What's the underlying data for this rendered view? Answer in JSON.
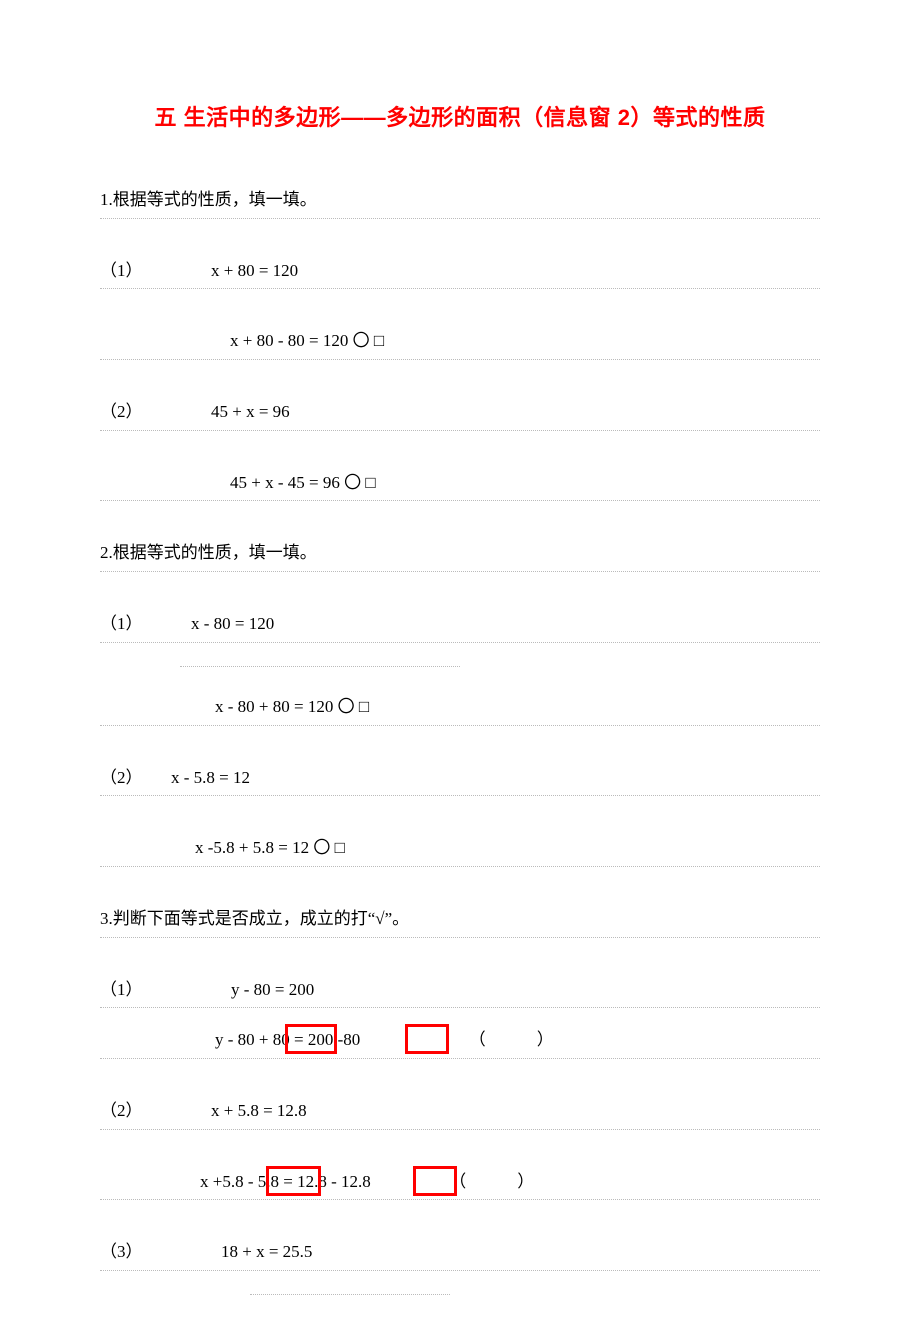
{
  "title": "五 生活中的多边形——多边形的面积（信息窗 2）等式的性质",
  "q1": {
    "prompt": "1.根据等式的性质，填一填。",
    "p1_label": "（1）",
    "p1_eq1": "x + 80   = 120",
    "p1_eq2": "x + 80 - 80 = 120 〇 □",
    "p2_label": "（2）",
    "p2_eq1": "45 + x  = 96",
    "p2_eq2": "45 + x - 45 = 96 〇 □"
  },
  "q2": {
    "prompt": "2.根据等式的性质，填一填。",
    "p1_label": "（1）",
    "p1_eq1": "x - 80   = 120",
    "p1_eq2": "x - 80 + 80   = 120 〇 □",
    "p2_label": "（2）",
    "p2_eq1": "x - 5.8    = 12",
    "p2_eq2": "x -5.8 + 5.8   = 12   〇 □"
  },
  "q3": {
    "prompt": "3.判断下面等式是否成立，成立的打“√”。",
    "p1_label": "（1）",
    "p1_eq1": "y - 80   = 200",
    "p1_eq2_a": "y - 80 + ",
    "p1_eq2_b": "80   = ",
    "p1_eq2_c": "200 -80",
    "p1_paren": "（　　　）",
    "p2_label": "（2）",
    "p2_eq1": "x + 5.8    = 12.8",
    "p2_eq2_a": "x +5.8 - ",
    "p2_eq2_b": "5.8   = ",
    "p2_eq2_c": "12.8 - 12.",
    "p2_eq2_d": "8",
    "p2_paren": "（　　　）",
    "p3_label": "（3）",
    "p3_eq1": "18  +  x   =  25.5"
  }
}
